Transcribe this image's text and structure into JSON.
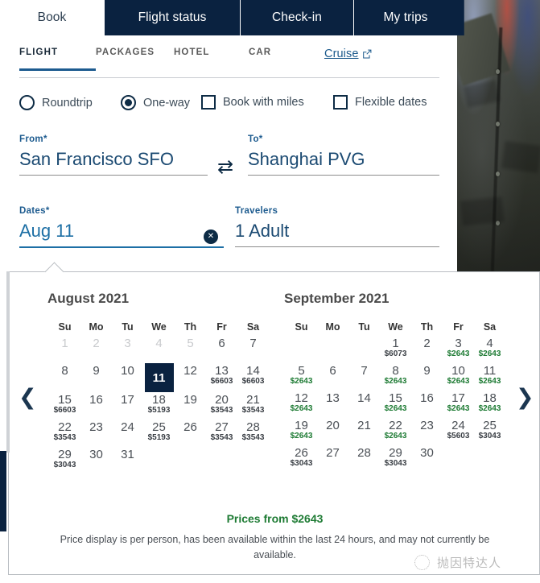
{
  "top_tabs": [
    {
      "label": "Book",
      "active": true
    },
    {
      "label": "Flight status",
      "active": false
    },
    {
      "label": "Check-in",
      "active": false
    },
    {
      "label": "My trips",
      "active": false
    }
  ],
  "sub_tabs": [
    {
      "label": "FLIGHT",
      "active": true,
      "external": false
    },
    {
      "label": "PACKAGES",
      "active": false,
      "external": false
    },
    {
      "label": "HOTEL",
      "active": false,
      "external": false
    },
    {
      "label": "CAR",
      "active": false,
      "external": false
    },
    {
      "label": "Cruise",
      "active": false,
      "external": true
    }
  ],
  "trip_options": [
    {
      "label": "Roundtrip",
      "type": "radio",
      "checked": false
    },
    {
      "label": "One-way",
      "type": "radio",
      "checked": true
    },
    {
      "label": "Book with miles",
      "type": "checkbox",
      "checked": false
    },
    {
      "label": "Flexible dates",
      "type": "checkbox",
      "checked": false
    }
  ],
  "form": {
    "from": {
      "label": "From*",
      "value": "San Francisco SFO"
    },
    "to": {
      "label": "To*",
      "value": "Shanghai PVG"
    },
    "swap_icon": "swap-horizontal-icon",
    "dates": {
      "label": "Dates*",
      "value": "Aug 11",
      "clear_icon": "clear-circle-icon"
    },
    "travelers": {
      "label": "Travelers",
      "value": "1 Adult"
    }
  },
  "calendar": {
    "prev_icon": "chevron-left-icon",
    "next_icon": "chevron-right-icon",
    "weekdays": [
      "Su",
      "Mo",
      "Tu",
      "We",
      "Th",
      "Fr",
      "Sa"
    ],
    "months": [
      {
        "title": "August 2021",
        "lead_blanks": 0,
        "days": [
          {
            "d": "1",
            "price": null,
            "state": "disabled"
          },
          {
            "d": "2",
            "price": null,
            "state": "disabled"
          },
          {
            "d": "3",
            "price": null,
            "state": "disabled"
          },
          {
            "d": "4",
            "price": null,
            "state": "disabled"
          },
          {
            "d": "5",
            "price": null,
            "state": "disabled"
          },
          {
            "d": "6",
            "price": null,
            "state": "normal"
          },
          {
            "d": "7",
            "price": null,
            "state": "normal"
          },
          {
            "d": "8",
            "price": null,
            "state": "normal"
          },
          {
            "d": "9",
            "price": null,
            "state": "normal"
          },
          {
            "d": "10",
            "price": null,
            "state": "normal"
          },
          {
            "d": "11",
            "price": null,
            "state": "selected"
          },
          {
            "d": "12",
            "price": null,
            "state": "normal"
          },
          {
            "d": "13",
            "price": "$6603",
            "state": "normal",
            "cheap": false
          },
          {
            "d": "14",
            "price": "$6603",
            "state": "normal",
            "cheap": false
          },
          {
            "d": "15",
            "price": "$6603",
            "state": "normal",
            "cheap": false
          },
          {
            "d": "16",
            "price": null,
            "state": "normal"
          },
          {
            "d": "17",
            "price": null,
            "state": "normal"
          },
          {
            "d": "18",
            "price": "$5193",
            "state": "normal",
            "cheap": false
          },
          {
            "d": "19",
            "price": null,
            "state": "normal"
          },
          {
            "d": "20",
            "price": "$3543",
            "state": "normal",
            "cheap": false
          },
          {
            "d": "21",
            "price": "$3543",
            "state": "normal",
            "cheap": false
          },
          {
            "d": "22",
            "price": "$3543",
            "state": "normal",
            "cheap": false
          },
          {
            "d": "23",
            "price": null,
            "state": "normal"
          },
          {
            "d": "24",
            "price": null,
            "state": "normal"
          },
          {
            "d": "25",
            "price": "$5193",
            "state": "normal",
            "cheap": false
          },
          {
            "d": "26",
            "price": null,
            "state": "normal"
          },
          {
            "d": "27",
            "price": "$3543",
            "state": "normal",
            "cheap": false
          },
          {
            "d": "28",
            "price": "$3543",
            "state": "normal",
            "cheap": false
          },
          {
            "d": "29",
            "price": "$3043",
            "state": "normal",
            "cheap": false
          },
          {
            "d": "30",
            "price": null,
            "state": "normal"
          },
          {
            "d": "31",
            "price": null,
            "state": "normal"
          }
        ]
      },
      {
        "title": "September 2021",
        "lead_blanks": 3,
        "days": [
          {
            "d": "1",
            "price": "$6073",
            "state": "normal",
            "cheap": false
          },
          {
            "d": "2",
            "price": null,
            "state": "normal"
          },
          {
            "d": "3",
            "price": "$2643",
            "state": "normal",
            "cheap": true
          },
          {
            "d": "4",
            "price": "$2643",
            "state": "normal",
            "cheap": true
          },
          {
            "d": "5",
            "price": "$2643",
            "state": "normal",
            "cheap": true
          },
          {
            "d": "6",
            "price": null,
            "state": "normal"
          },
          {
            "d": "7",
            "price": null,
            "state": "normal"
          },
          {
            "d": "8",
            "price": "$2643",
            "state": "normal",
            "cheap": true
          },
          {
            "d": "9",
            "price": null,
            "state": "normal"
          },
          {
            "d": "10",
            "price": "$2643",
            "state": "normal",
            "cheap": true
          },
          {
            "d": "11",
            "price": "$2643",
            "state": "normal",
            "cheap": true
          },
          {
            "d": "12",
            "price": "$2643",
            "state": "normal",
            "cheap": true
          },
          {
            "d": "13",
            "price": null,
            "state": "normal"
          },
          {
            "d": "14",
            "price": null,
            "state": "normal"
          },
          {
            "d": "15",
            "price": "$2643",
            "state": "normal",
            "cheap": true
          },
          {
            "d": "16",
            "price": null,
            "state": "normal"
          },
          {
            "d": "17",
            "price": "$2643",
            "state": "normal",
            "cheap": true
          },
          {
            "d": "18",
            "price": "$2643",
            "state": "normal",
            "cheap": true
          },
          {
            "d": "19",
            "price": "$2643",
            "state": "normal",
            "cheap": true
          },
          {
            "d": "20",
            "price": null,
            "state": "normal"
          },
          {
            "d": "21",
            "price": null,
            "state": "normal"
          },
          {
            "d": "22",
            "price": "$2643",
            "state": "normal",
            "cheap": true
          },
          {
            "d": "23",
            "price": null,
            "state": "normal"
          },
          {
            "d": "24",
            "price": "$5603",
            "state": "normal",
            "cheap": false
          },
          {
            "d": "25",
            "price": "$3043",
            "state": "normal",
            "cheap": false
          },
          {
            "d": "26",
            "price": "$3043",
            "state": "normal",
            "cheap": false
          },
          {
            "d": "27",
            "price": null,
            "state": "normal"
          },
          {
            "d": "28",
            "price": null,
            "state": "normal"
          },
          {
            "d": "29",
            "price": "$3043",
            "state": "normal",
            "cheap": false
          },
          {
            "d": "30",
            "price": null,
            "state": "normal"
          }
        ]
      }
    ],
    "footer": {
      "prices_from": "Prices from $2643",
      "disclaimer": "Price display is per person, has been available within the last 24 hours, and may not currently be available."
    }
  },
  "watermark": {
    "text": "抛因特达人",
    "logo_icon": "watermark-logo-icon"
  },
  "colors": {
    "brand_navy": "#0a2240",
    "link_blue": "#1d6fa5",
    "cheap_green": "#1e7b34",
    "text_gray": "#4a4f55"
  }
}
